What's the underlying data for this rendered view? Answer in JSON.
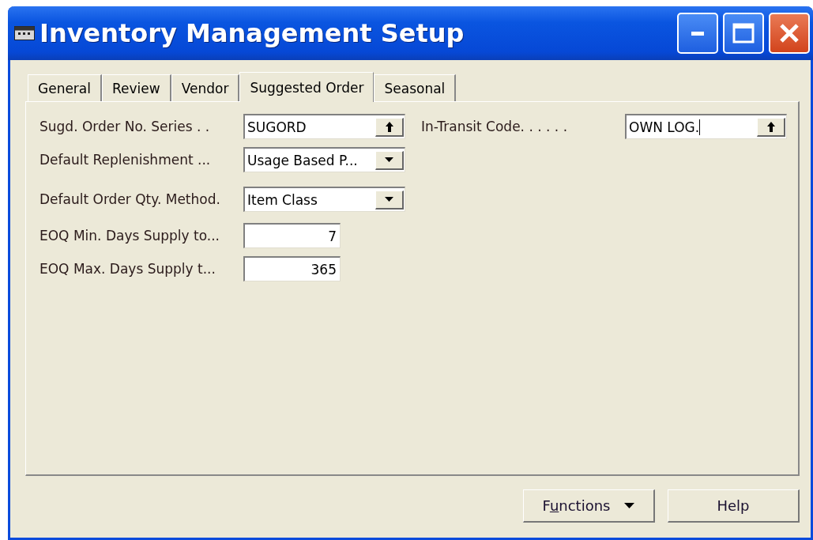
{
  "window": {
    "title": "Inventory Management Setup"
  },
  "tabs": [
    {
      "label": "General",
      "selected": false
    },
    {
      "label": "Review",
      "selected": false
    },
    {
      "label": "Vendor",
      "selected": false
    },
    {
      "label": "Suggested Order",
      "selected": true
    },
    {
      "label": "Seasonal",
      "selected": false
    }
  ],
  "left_fields": [
    {
      "label": "Sugd. Order No. Series . .",
      "value": "SUGORD",
      "kind": "lookup",
      "focused": false
    },
    {
      "label": "Default Replenishment ...",
      "value": "Usage Based P...",
      "kind": "dropdown",
      "focused": false
    },
    {
      "label": "Default Order Qty. Method.",
      "value": "Item Class",
      "kind": "dropdown",
      "focused": false
    },
    {
      "label": "EOQ Min. Days Supply to...",
      "value": "7",
      "kind": "number",
      "focused": false
    },
    {
      "label": "EOQ Max. Days Supply t...",
      "value": "365",
      "kind": "number",
      "focused": false
    }
  ],
  "right_fields": [
    {
      "label": "In-Transit Code. . . . . .",
      "value": "OWN LOG.",
      "kind": "lookup",
      "focused": true
    }
  ],
  "buttons": [
    {
      "label_before_key": "F",
      "access_key": "u",
      "label_after_key": "nctions",
      "kind": "menu"
    },
    {
      "label": "Help",
      "kind": "plain"
    }
  ]
}
